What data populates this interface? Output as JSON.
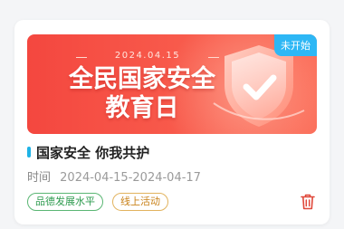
{
  "banner": {
    "date": "2024.04.15",
    "headline_line1": "全民国家安全",
    "headline_line2": "教育日",
    "status_tag": "未开始"
  },
  "event": {
    "title": "国家安全  你我共护",
    "time_label": "时间",
    "time_value": "2024-04-15-2024-04-17",
    "tags": [
      "品德发展水平",
      "线上活动"
    ]
  },
  "icons": {
    "delete": "trash-icon",
    "shield": "shield-check-icon"
  },
  "colors": {
    "banner_red": "#f4473f",
    "status_blue": "#2db7f5",
    "tag_green": "#2e9b4f",
    "tag_orange": "#c9831b",
    "delete_red": "#e0483a"
  }
}
